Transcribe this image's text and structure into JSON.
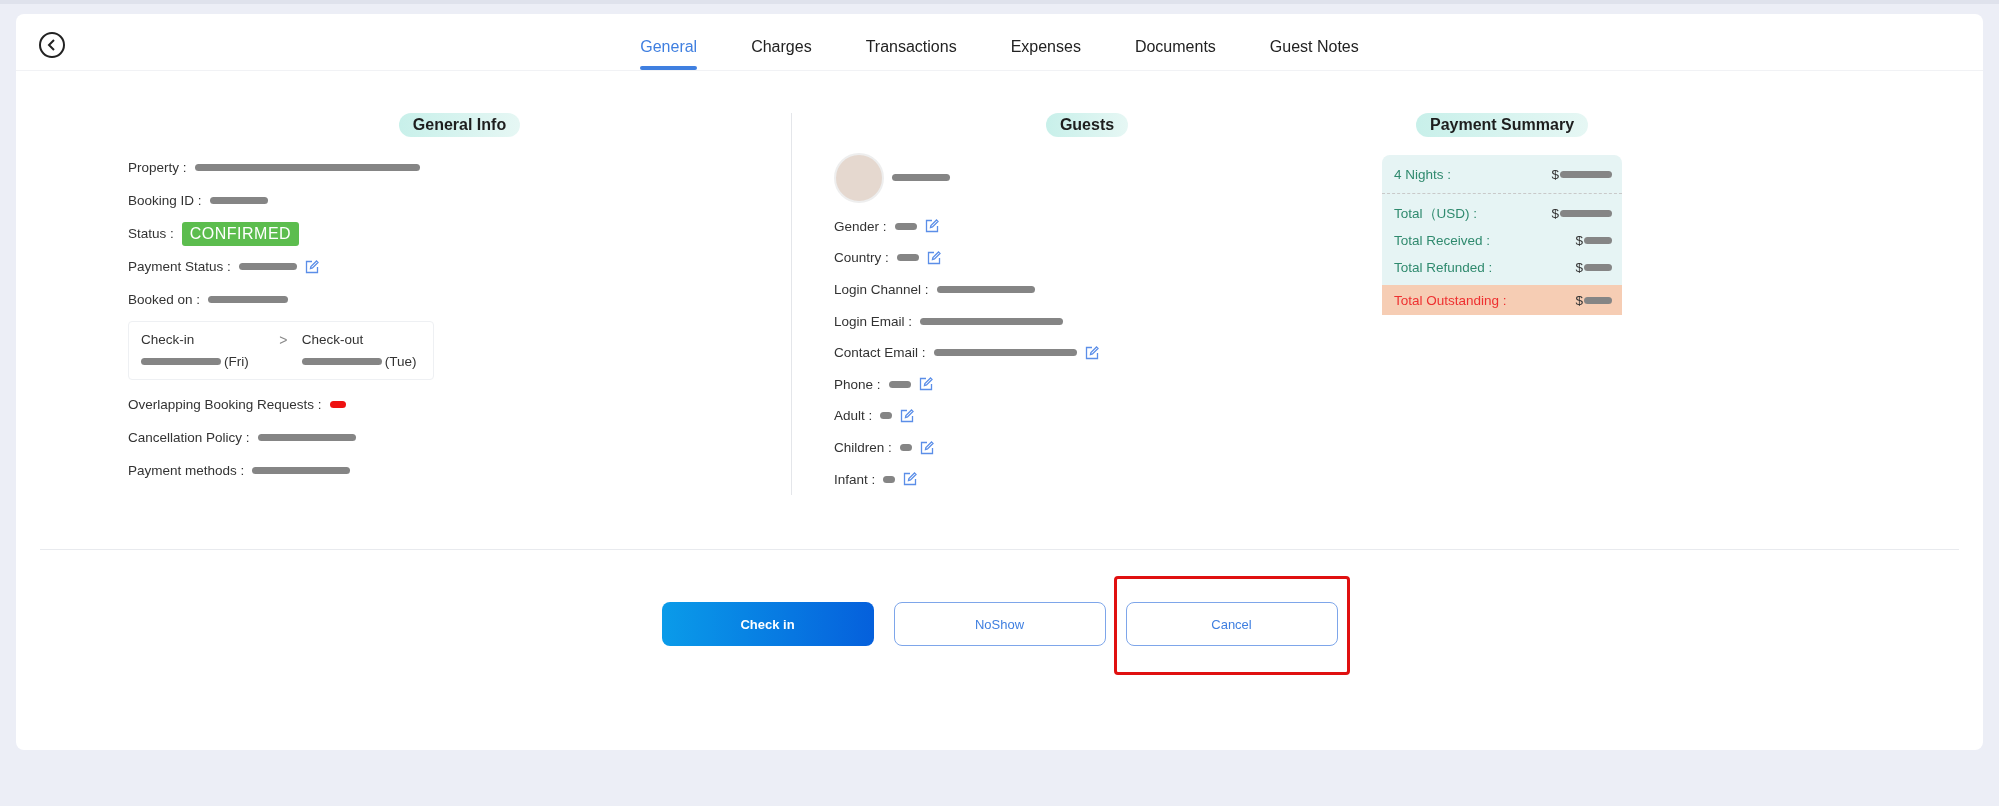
{
  "tabs": [
    {
      "label": "General",
      "selected": true
    },
    {
      "label": "Charges",
      "selected": false
    },
    {
      "label": "Transactions",
      "selected": false
    },
    {
      "label": "Expenses",
      "selected": false
    },
    {
      "label": "Documents",
      "selected": false
    },
    {
      "label": "Guest Notes",
      "selected": false
    }
  ],
  "general_info": {
    "title": "General Info",
    "fields": [
      {
        "kind": "hugebar",
        "label": "Property :",
        "editable": false
      },
      {
        "kind": "midbar",
        "label": "Booking ID :",
        "editable": false
      },
      {
        "kind": "badge",
        "label": "Status :",
        "value": "CONFIRMED"
      },
      {
        "kind": "midbar",
        "label": "Payment Status :",
        "editable": true
      },
      {
        "kind": "largebar",
        "label": "Booked on :",
        "editable": false
      },
      {
        "kind": "dates",
        "from_label": "Check-in",
        "separator": ">",
        "to_label": "Check-out",
        "from_day": "(Fri)",
        "to_day": "(Tue)"
      },
      {
        "kind": "dot",
        "label": "Overlapping Booking Requests :",
        "color": "#ee1111"
      },
      {
        "kind": "longbar",
        "label": "Cancellation Policy :",
        "editable": false
      },
      {
        "kind": "longbar",
        "label": "Payment methods :",
        "editable": false
      }
    ]
  },
  "guests": {
    "title": "Guests",
    "fields": [
      {
        "kind": "smallbar",
        "label": "Gender :",
        "editable": true
      },
      {
        "kind": "smallbar",
        "label": "Country :",
        "editable": true
      },
      {
        "kind": "longbar",
        "label": "Login Channel :",
        "editable": false
      },
      {
        "kind": "widebar",
        "label": "Login Email :",
        "editable": false
      },
      {
        "kind": "widebar",
        "label": "Contact Email :",
        "editable": true
      },
      {
        "kind": "smallbar",
        "label": "Phone :",
        "editable": true
      },
      {
        "kind": "tinybar",
        "label": "Adult :",
        "editable": true
      },
      {
        "kind": "tinybar",
        "label": "Children :",
        "editable": true
      },
      {
        "kind": "tinybar",
        "label": "Infant :",
        "editable": true
      }
    ]
  },
  "payment_summary": {
    "title": "Payment Summary",
    "rows": [
      {
        "kind": "midbar",
        "label": "4 Nights :",
        "currency": "$",
        "alert": false,
        "divider_after": true
      },
      {
        "kind": "midbar",
        "label": "Total（USD) :",
        "currency": "$",
        "alert": false,
        "divider_after": false
      },
      {
        "kind": "smallbar",
        "label": "Total Received :",
        "currency": "$",
        "alert": false,
        "divider_after": false
      },
      {
        "kind": "smallbar",
        "label": "Total Refunded :",
        "currency": "$",
        "alert": false,
        "divider_after": false
      },
      {
        "kind": "smallbar",
        "label": "Total Outstanding :",
        "currency": "$",
        "alert": true,
        "divider_after": false
      }
    ]
  },
  "actions": [
    {
      "label": "Check in",
      "kind": "primary",
      "highlighted": false
    },
    {
      "label": "NoShow",
      "kind": "outline",
      "highlighted": false
    },
    {
      "label": "Cancel",
      "kind": "outline",
      "highlighted": true
    }
  ]
}
